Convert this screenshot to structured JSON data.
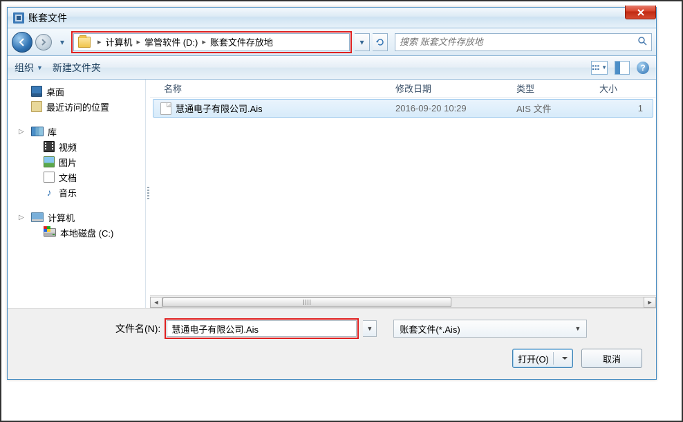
{
  "window": {
    "title": "账套文件"
  },
  "nav": {
    "crumbs": [
      "计算机",
      "掌管软件 (D:)",
      "账套文件存放地"
    ],
    "search_placeholder": "搜索 账套文件存放地"
  },
  "toolbar": {
    "organize": "组织",
    "newfolder": "新建文件夹"
  },
  "sidebar": {
    "desktop": "桌面",
    "recent": "最近访问的位置",
    "library": "库",
    "video": "视频",
    "pictures": "图片",
    "documents": "文档",
    "music": "音乐",
    "computer": "计算机",
    "drive_c": "本地磁盘 (C:)"
  },
  "columns": {
    "name": "名称",
    "modified": "修改日期",
    "type": "类型",
    "size": "大小"
  },
  "files": [
    {
      "name": "慧通电子有限公司.Ais",
      "modified": "2016-09-20 10:29",
      "type": "AIS 文件",
      "size": "1"
    }
  ],
  "footer": {
    "filename_label": "文件名(N):",
    "filename_value": "慧通电子有限公司.Ais",
    "filter": "账套文件(*.Ais)",
    "open": "打开(O)",
    "cancel": "取消"
  }
}
